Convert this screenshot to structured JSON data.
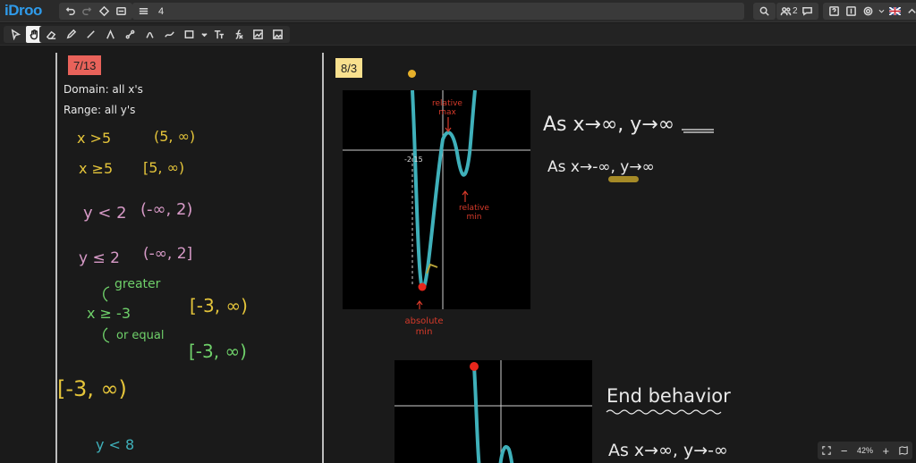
{
  "app": {
    "logo": "iDroo"
  },
  "board": {
    "title": "4"
  },
  "users": {
    "count": "2"
  },
  "toolbar": {
    "tools": [
      "select",
      "hand",
      "eraser",
      "pen",
      "line",
      "arrow",
      "connector",
      "brush",
      "smooth-line",
      "rectangle",
      "text",
      "formula",
      "graph",
      "image"
    ]
  },
  "left": {
    "date": "7/13",
    "domain": "Domain: all x's",
    "range": "Range: all y's",
    "ineq1": "x >5",
    "int1": "(5, ∞)",
    "ineq2": "x ≥5",
    "int2": "[5, ∞)",
    "ineq3": "y < 2",
    "int3": "(-∞, 2)",
    "ineq4": "y ≤ 2",
    "int4": "(-∞, 2]",
    "note_greater": "greater",
    "ineq5": "x ≥ -3",
    "note_equal": "or equal",
    "int5a": "[-3, ∞)",
    "int5b": "[-3, ∞)",
    "int5c": "[-3, ∞)",
    "ineq6": "y < 8"
  },
  "right": {
    "date": "8/3",
    "graph1_labels": {
      "rel_max": "relative max",
      "rel_min": "relative min",
      "abs_min": "absolute min",
      "tick": "-2.15"
    },
    "end1a": "As x→∞, y→∞",
    "end1b": "As x→-∞, y→∞",
    "end_title": "End behavior",
    "end2": "As x→∞, y→-∞"
  },
  "zoom": {
    "level": "42%"
  },
  "colors": {
    "accent": "#2f9bea",
    "curve": "#3fb0ba",
    "red_dot": "#e8271c",
    "yellow": "#e4c43a",
    "pink": "#d79ac7",
    "green": "#6fd06a",
    "annotation": "#d63a2a",
    "date_red": "#e8625a",
    "date_yellow": "#f8e08e"
  }
}
